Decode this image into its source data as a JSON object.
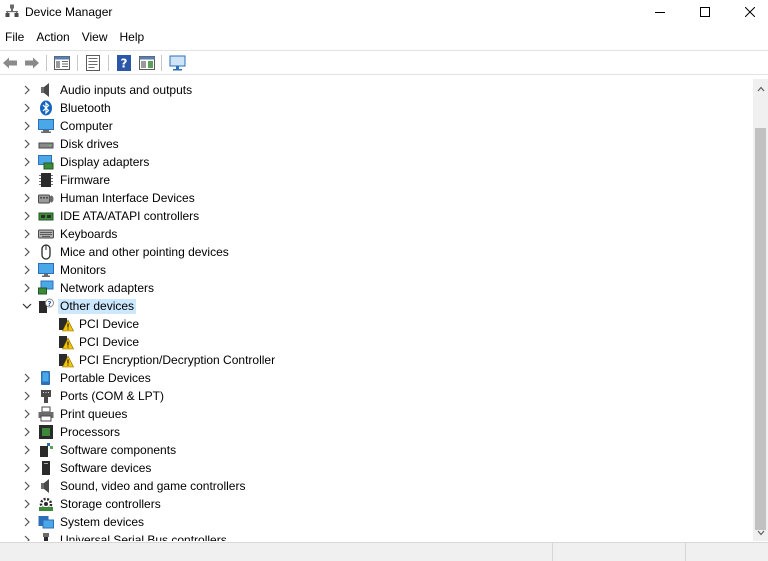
{
  "window": {
    "title": "Device Manager"
  },
  "menu": [
    "File",
    "Action",
    "View",
    "Help"
  ],
  "tree": [
    {
      "label": "Audio inputs and outputs",
      "icon": "speaker-icon",
      "expanded": false
    },
    {
      "label": "Bluetooth",
      "icon": "bluetooth-icon",
      "expanded": false
    },
    {
      "label": "Computer",
      "icon": "computer-icon",
      "expanded": false
    },
    {
      "label": "Disk drives",
      "icon": "disk-drive-icon",
      "expanded": false
    },
    {
      "label": "Display adapters",
      "icon": "display-adapter-icon",
      "expanded": false
    },
    {
      "label": "Firmware",
      "icon": "firmware-icon",
      "expanded": false
    },
    {
      "label": "Human Interface Devices",
      "icon": "hid-icon",
      "expanded": false
    },
    {
      "label": "IDE ATA/ATAPI controllers",
      "icon": "ide-controller-icon",
      "expanded": false
    },
    {
      "label": "Keyboards",
      "icon": "keyboard-icon",
      "expanded": false
    },
    {
      "label": "Mice and other pointing devices",
      "icon": "mouse-icon",
      "expanded": false
    },
    {
      "label": "Monitors",
      "icon": "monitor-icon",
      "expanded": false
    },
    {
      "label": "Network adapters",
      "icon": "network-adapter-icon",
      "expanded": false
    },
    {
      "label": "Other devices",
      "icon": "unknown-device-icon",
      "expanded": true,
      "selected": true
    },
    {
      "label": "PCI Device",
      "icon": "warning-device-icon",
      "child": true
    },
    {
      "label": "PCI Device",
      "icon": "warning-device-icon",
      "child": true
    },
    {
      "label": "PCI Encryption/Decryption Controller",
      "icon": "warning-device-icon",
      "child": true
    },
    {
      "label": "Portable Devices",
      "icon": "portable-device-icon",
      "expanded": false
    },
    {
      "label": "Ports (COM & LPT)",
      "icon": "port-icon",
      "expanded": false
    },
    {
      "label": "Print queues",
      "icon": "printer-icon",
      "expanded": false
    },
    {
      "label": "Processors",
      "icon": "processor-icon",
      "expanded": false
    },
    {
      "label": "Software components",
      "icon": "software-component-icon",
      "expanded": false
    },
    {
      "label": "Software devices",
      "icon": "software-device-icon",
      "expanded": false
    },
    {
      "label": "Sound, video and game controllers",
      "icon": "speaker-icon",
      "expanded": false
    },
    {
      "label": "Storage controllers",
      "icon": "storage-controller-icon",
      "expanded": false
    },
    {
      "label": "System devices",
      "icon": "system-device-icon",
      "expanded": false
    },
    {
      "label": "Universal Serial Bus controllers",
      "icon": "usb-icon",
      "expanded": false
    }
  ],
  "colors": {
    "selection": "#cce8ff",
    "accent": "#0078d7",
    "warning": "#f5c400"
  }
}
